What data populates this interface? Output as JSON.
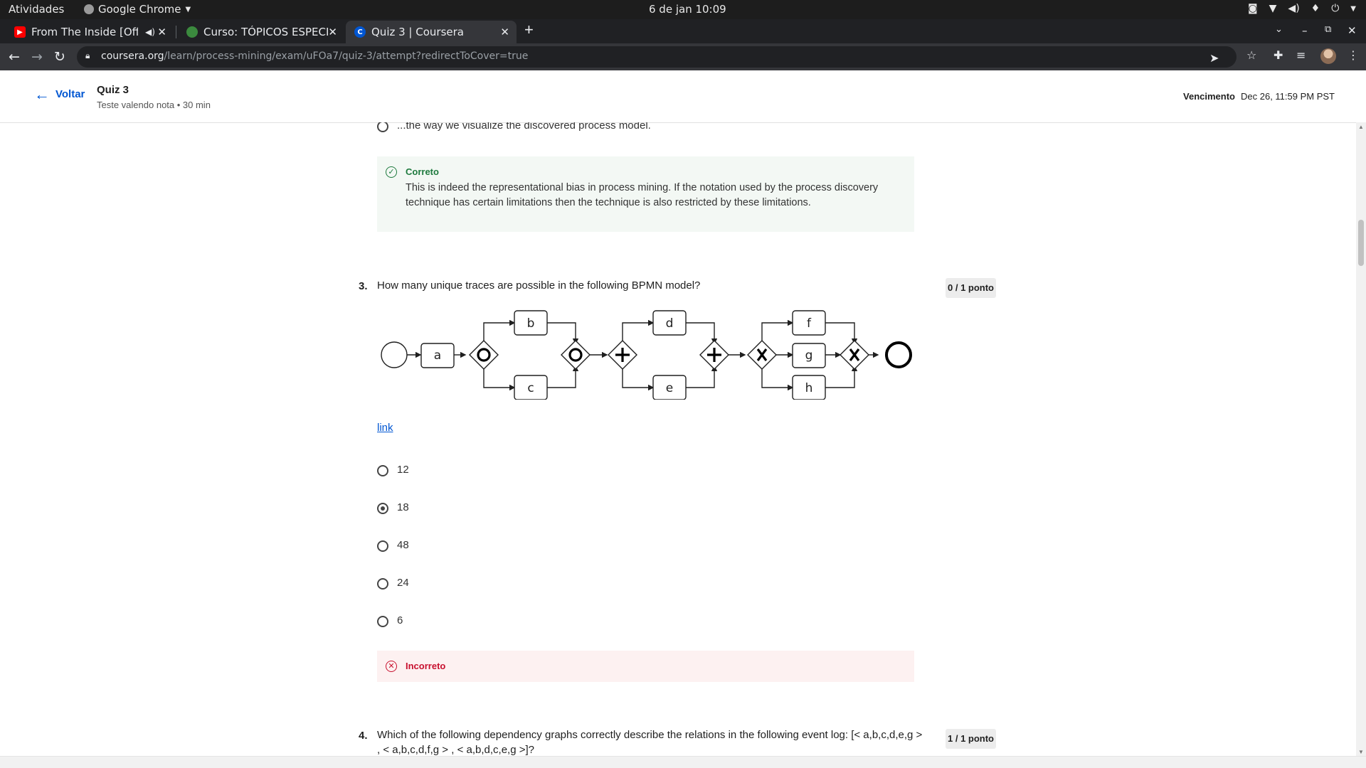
{
  "system_bar": {
    "activities": "Atividades",
    "app_name": "Google Chrome",
    "clock": "6 de jan  10:09"
  },
  "tabs": [
    {
      "label": "From The Inside [Offic",
      "icon": "youtube-icon"
    },
    {
      "label": "Curso: TÓPICOS ESPECIAI",
      "icon": "gov-icon"
    },
    {
      "label": "Quiz 3 | Coursera",
      "icon": "coursera-icon",
      "active": true
    }
  ],
  "address_bar": {
    "domain": "coursera.org",
    "path": "/learn/process-mining/exam/uFOa7/quiz-3/attempt?redirectToCover=true"
  },
  "header": {
    "back_label": "Voltar",
    "quiz_title": "Quiz 3",
    "quiz_subtitle": "Teste valendo nota • 30 min",
    "due_label": "Vencimento",
    "due_value": "Dec 26, 11:59 PM PST"
  },
  "question2": {
    "last_option": "...the way we visualize the discovered process model.",
    "feedback_title": "Correto",
    "feedback_text": "This is indeed the representational bias in process mining. If the notation used by the process discovery technique has certain limitations then the technique is also restricted by these limitations."
  },
  "question3": {
    "number": "3.",
    "text": "How many unique traces are possible in the following BPMN model?",
    "score": "0 / 1 ponto",
    "diagram_labels": {
      "a": "a",
      "b": "b",
      "c": "c",
      "d": "d",
      "e": "e",
      "f": "f",
      "g": "g",
      "h": "h"
    },
    "link_text": "link",
    "options": [
      {
        "label": "12",
        "selected": false
      },
      {
        "label": "18",
        "selected": true
      },
      {
        "label": "48",
        "selected": false
      },
      {
        "label": "24",
        "selected": false
      },
      {
        "label": "6",
        "selected": false
      }
    ],
    "feedback_title": "Incorreto"
  },
  "question4": {
    "number": "4.",
    "text_line1": "Which of the following dependency graphs correctly describe the relations in the following event log: [< a,b,c,d,e,g >",
    "text_line2": ", < a,b,c,d,f,g > , < a,b,d,c,e,g >]?",
    "score": "1 / 1 ponto"
  },
  "colors": {
    "accent": "#0056d2",
    "correct": "#1e7a3e",
    "incorrect": "#c8102e",
    "correct_bg": "#f3f8f4",
    "incorrect_bg": "#fdf1f1"
  }
}
